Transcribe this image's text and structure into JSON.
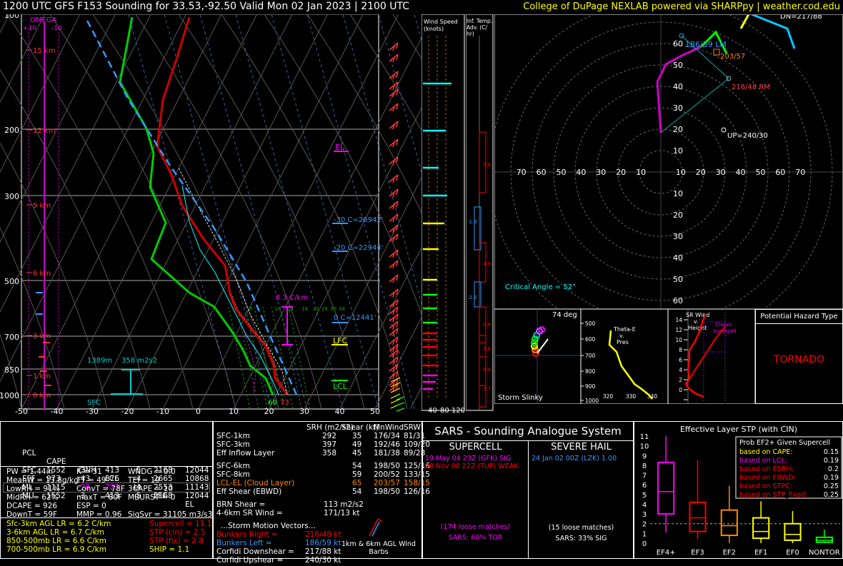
{
  "header": {
    "title": "1200 UTC GFS F153 Sounding for 33.53,-92.50 Valid  Mon 02 Jan 2023 | 2100 UTC",
    "credit": "College of DuPage NEXLAB powered via SHARPpy | weather.cod.edu"
  },
  "skewt": {
    "pressure_ticks": [
      "100",
      "200",
      "300",
      "500",
      "700",
      "850",
      "1000"
    ],
    "temp_ticks": [
      "-50",
      "-40",
      "-30",
      "-20",
      "-10",
      "0",
      "10",
      "20",
      "30",
      "40",
      "50"
    ],
    "height_ticks": [
      "15 km",
      "12 km",
      "9 km",
      "6 km",
      "3 km",
      "1 km",
      "0 km"
    ],
    "omega_label": "OMEGA",
    "omega_scale": [
      "+10",
      "-10"
    ],
    "labels": {
      "el": "EL",
      "lfc": "LFC",
      "lcl": "LCL",
      "m30": "-30 C=26942'",
      "m20": "-20 C=22944'",
      "zero": "0 C=12441'",
      "lapse": "8.3 C/km",
      "eff_base": "1389m",
      "eff_srh": "358 m2s2",
      "sfc": "SFC",
      "sfc_td": "68",
      "sfc_t": "73",
      "mix_ratios": [
        "6",
        "10",
        "14",
        "18",
        "22",
        "26",
        "30",
        "34"
      ]
    }
  },
  "wind_speed_panel": {
    "title": "Wind Speed (knots)",
    "ticks": [
      "40",
      "80",
      "120"
    ]
  },
  "temp_adv_panel": {
    "title": "Inf. Temp. Adv. (C/hr)",
    "values": [
      "5.6",
      "-1.8",
      "4.9",
      "-2.5",
      "0.8",
      "2.6",
      "8.4",
      "3.7"
    ]
  },
  "hodograph": {
    "rings_y": [
      "60",
      "50",
      "40",
      "30",
      "20",
      "10"
    ],
    "rings_y_neg": [
      "10",
      "20",
      "30",
      "40",
      "50",
      "60"
    ],
    "rings_x": [
      "70",
      "60",
      "50",
      "40",
      "30",
      "20",
      "10",
      "10",
      "20",
      "30",
      "40",
      "50",
      "60",
      "70"
    ],
    "left_mover": "186/59 LM",
    "right_mover": "216/48 RM",
    "mean_wind": "203/57",
    "up": "UP=240/30",
    "critical_angle": "Critical Angle = 52°",
    "corner": "DN=217/88"
  },
  "storm_slinky": {
    "title": "Storm Slinky",
    "angle": "74 deg"
  },
  "theta_e": {
    "title": "Theta-E v. Pres",
    "pressures": [
      "500",
      "600",
      "700",
      "800",
      "900",
      "1000"
    ],
    "theta": [
      "320",
      "330",
      "340"
    ]
  },
  "sr_wind": {
    "title": "SR Wind v. Height",
    "heights": [
      "14",
      "12",
      "10",
      "8",
      "6",
      "4",
      "2",
      "0"
    ],
    "note": "Classic Supercell"
  },
  "hazard": {
    "title": "Potential Hazard Type",
    "value": "TORNADO"
  },
  "parcels": {
    "headers": [
      "PCL",
      "CAPE",
      "CINH",
      "LCL",
      "LI",
      "LFC",
      "EL"
    ],
    "rows": [
      {
        "pcl": "SFC",
        "cape": "1552",
        "cinh": "-3",
        "lcl": "413",
        "li": "-5",
        "lfc": "2168",
        "el": "12044"
      },
      {
        "pcl": "EFF",
        "cape": "973",
        "cinh": "-43",
        "lcl": "876",
        "li": "-4",
        "lfc": "2665",
        "el": "10868"
      },
      {
        "pcl": "ML",
        "cape": "1115",
        "cinh": "-28",
        "lcl": "723",
        "li": "-4",
        "lfc": "2553",
        "el": "11143"
      },
      {
        "pcl": "MU",
        "cape": "1552",
        "cinh": "-3",
        "lcl": "413",
        "li": "-5",
        "lfc": "2168",
        "el": "12044"
      }
    ]
  },
  "thermo": [
    [
      "PW = 1.44in",
      "K = 31",
      "WNDG = 0.0"
    ],
    [
      "MeanW = 13.8g/kg",
      "TT = 49",
      "TEI = 19"
    ],
    [
      "LowRH = 91%",
      "ConvT = 78F",
      "3CAPE = 10"
    ],
    [
      "MidRH = 62%",
      "maxT = 80F",
      "MBURST = 0"
    ],
    [
      "DCAPE = 926",
      "ESP = 0",
      ""
    ],
    [
      "DownT = 59F",
      "MMP = 0.96",
      "SigSvr = 31105 m3/s3"
    ]
  ],
  "lapse_rates": [
    "Sfc-3km AGL LR = 6.2 C/km",
    "3-6km AGL LR = 6.7 C/km",
    "850-500mb LR = 6.6 C/km",
    "700-500mb LR = 6.9 C/km"
  ],
  "composite": [
    "Supercell = 11.1",
    "STP (cin) = 2.5",
    "STP (fix) = 2.8",
    "SHIP = 1.1"
  ],
  "kinematic": {
    "headers": [
      "SRH (m2/s2)",
      "Shear (kt)",
      "MnWind",
      "SRW"
    ],
    "rows": [
      [
        "SFC-1km",
        "292",
        "35",
        "176/34",
        "81/31"
      ],
      [
        "SFC-3km",
        "397",
        "49",
        "192/46",
        "109/20"
      ],
      [
        "Eff Inflow Layer",
        "358",
        "45",
        "181/38",
        "89/28"
      ],
      [
        "SFC-6km",
        "54",
        "198/50",
        "125/16",
        ""
      ],
      [
        "SFC-8km",
        "59",
        "200/52",
        "133/15",
        ""
      ],
      [
        "LCL-EL (Cloud Layer)",
        "65",
        "203/57",
        "158/15",
        ""
      ],
      [
        "Eff Shear (EBWD)",
        "54",
        "198/50",
        "126/16",
        ""
      ]
    ],
    "brn": [
      "BRN Shear =",
      "113 m2/s2"
    ],
    "sr46": [
      "4-6km SR Wind =",
      "171/13 kt"
    ],
    "vectors_title": "...Storm Motion Vectors...",
    "vectors": [
      [
        "Bunkers Right =",
        "216/48 kt"
      ],
      [
        "Bunkers Left =",
        "186/59 kt"
      ],
      [
        "Corfidi Downshear =",
        "217/88 kt"
      ],
      [
        "Corfidi Upshear =",
        "240/30 kt"
      ]
    ],
    "barb_label": "1km & 6km AGL Wind Barbs"
  },
  "sars": {
    "title": "SARS - Sounding Analogue System",
    "supercell_title": "SUPERCELL",
    "supercell_matches": [
      "19 May 04 23Z (GFK)  SIG",
      "08 Nov 00 22Z (TUP)  WEAK"
    ],
    "supercell_loose": "(174 loose matches)",
    "supercell_pct": "SARS: 60% TOR",
    "hail_title": "SEVERE HAIL",
    "hail_matches": [
      "24 Jan 02 00Z (LZK)   1.00"
    ],
    "hail_loose": "(15 loose matches)",
    "hail_pct": "SARS: 33% SIG"
  },
  "chart_data": {
    "type": "box",
    "title": "Effective Layer STP (with CIN)",
    "categories": [
      "EF4+",
      "EF3",
      "EF2",
      "EF1",
      "EF0",
      "NONTOR"
    ],
    "ylim": [
      0,
      11
    ],
    "yticks": [
      "0",
      "1",
      "2",
      "3",
      "4",
      "5",
      "6",
      "7",
      "8",
      "9",
      "10",
      "11"
    ],
    "boxes": [
      {
        "low": 1.1,
        "q1": 3.0,
        "median": 5.3,
        "q3": 8.3,
        "high": 11.0,
        "color": "#ff00ff"
      },
      {
        "low": 0.4,
        "q1": 1.2,
        "median": 2.6,
        "q3": 4.2,
        "high": 8.5,
        "color": "#ff0000"
      },
      {
        "low": 0.0,
        "q1": 0.8,
        "median": 1.8,
        "q3": 3.4,
        "high": 5.9,
        "color": "#ff8800"
      },
      {
        "low": 0.0,
        "q1": 0.5,
        "median": 1.2,
        "q3": 2.6,
        "high": 4.3,
        "color": "#ffff00"
      },
      {
        "low": 0.0,
        "q1": 0.3,
        "median": 0.9,
        "q3": 2.0,
        "high": 3.3,
        "color": "#ffff00"
      },
      {
        "low": 0.0,
        "q1": 0.1,
        "median": 0.3,
        "q3": 0.6,
        "high": 1.4,
        "color": "#00ff00"
      }
    ],
    "prob_title": "Prob EF2+ Given Supercell",
    "prob_rows": [
      {
        "label": "based on CAPE:",
        "value": "0.15"
      },
      {
        "label": "based on LCL:",
        "value": "0.19"
      },
      {
        "label": "based on ESRH:",
        "value": "0.2"
      },
      {
        "label": "based on EBWD:",
        "value": "0.19"
      },
      {
        "label": "based on STPC:",
        "value": "0.25"
      },
      {
        "label": "based on STP_fixed:",
        "value": "0.25"
      }
    ]
  }
}
